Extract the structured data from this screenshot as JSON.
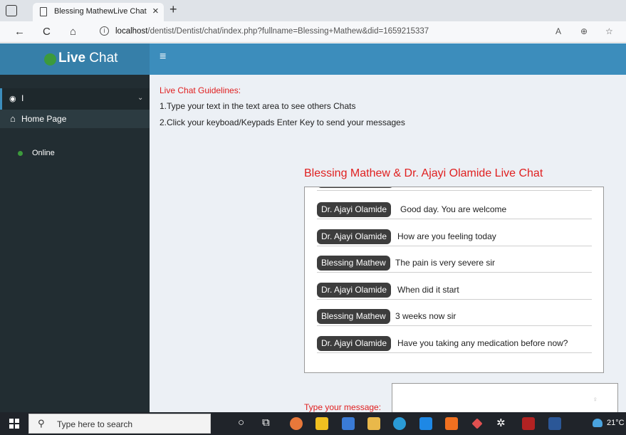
{
  "browser": {
    "tab_title": "Blessing MathewLive Chat",
    "tab_close": "×",
    "new_tab": "+",
    "url_host": "localhost",
    "url_path": "/dentist/Dentist/chat/index.php?fullname=Blessing+Mathew&did=1659215337",
    "back": "←",
    "refresh": "C",
    "home": "⌂",
    "info": "i",
    "read_aloud": "A",
    "zoom": "⊕",
    "favorites": "☆"
  },
  "app": {
    "logo_bold": "Live",
    "logo_rest": " Chat",
    "menu_toggle": "≡"
  },
  "sidebar": {
    "active_item_label": "I",
    "active_item_chevron": "⌄",
    "home_label": "Home Page",
    "status_label": "Online"
  },
  "main": {
    "guidelines_title": "Live Chat Guidelines:",
    "guideline_1": "1.Type your text in the text area to see others Chats",
    "guideline_2": "2.Click your keyboad/Keypads Enter Key to send your messages",
    "chat_title": "Blessing Mathew & Dr. Ajayi Olamide Live Chat",
    "messages": [
      {
        "sender": "Dr. Ajayi Olamide",
        "text": "Good day. You are welcome"
      },
      {
        "sender": "Dr. Ajayi Olamide",
        "text": "How are you feeling today"
      },
      {
        "sender": "Blessing Mathew",
        "text": "The pain is very severe sir"
      },
      {
        "sender": "Dr. Ajayi Olamide",
        "text": "When did it start"
      },
      {
        "sender": "Blessing Mathew",
        "text": "3 weeks now sir"
      },
      {
        "sender": "Dr. Ajayi Olamide",
        "text": "Have you taking any medication before now?"
      }
    ],
    "type_label": "Type your message:",
    "message_value": ""
  },
  "taskbar": {
    "search_placeholder": "Type here to search",
    "temperature": "21°C"
  },
  "colors": {
    "header": "#3c8dbc",
    "logo_bar": "#367fa9",
    "sidebar": "#222d32",
    "accent_red": "#e02020",
    "online_green": "#3c9a3c"
  }
}
